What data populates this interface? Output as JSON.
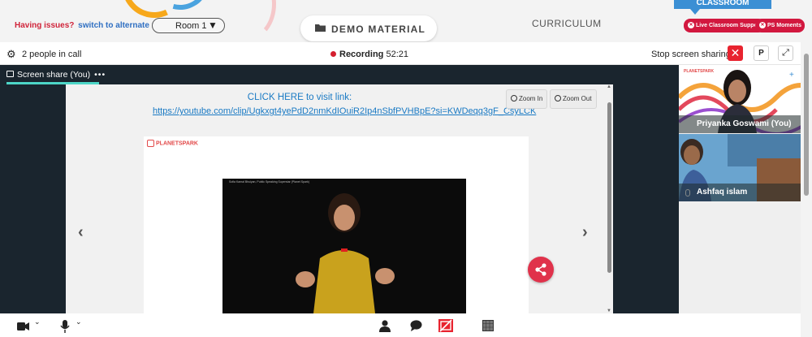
{
  "topbar": {
    "issues_text": "Having issues?",
    "switch_text": "switch to alternate room",
    "room_value": "Room 1",
    "demo_label": "DEMO MATERIAL",
    "curriculum_label": "CURRICULUM",
    "classroom_tab": "CLASSROOM",
    "live_support_label": "Live Classroom Support",
    "ps_moments_label": "PS Moments"
  },
  "call": {
    "people_count": "2 people in call",
    "recording_label": "Recording",
    "recording_time": "52:21",
    "stop_sharing_label": "Stop screen sharing",
    "p_button": "P"
  },
  "share": {
    "tab_label": "Screen share (You)",
    "click_here": "CLICK HERE to visit link:",
    "link": "https://youtube.com/clip/Ugkxgt4yePdD2nmKdIOuiR2Ip4nSbfPVHBpE?si=KWDeqq3gF_CsyLCK",
    "zoom_in": "Zoom In",
    "zoom_out": "Zoom Out",
    "brand": "PLANETSPARK",
    "video_title": "Sofia Kamal Bhuiyan, Public Speaking Superstar (Planet Spark)"
  },
  "participants": [
    {
      "name": "Priyanka Goswami (You)"
    },
    {
      "name": "Ashfaq islam"
    }
  ],
  "colors": {
    "accent_red": "#d2183f",
    "link_blue": "#1a7ac4",
    "tab_teal": "#4dd6c7",
    "dark_bg": "#1a252e"
  },
  "icons": [
    "gear-icon",
    "folder-icon",
    "camera-icon",
    "mic-icon",
    "person-icon",
    "chat-icon",
    "screen-share-off-icon",
    "layout-icon",
    "share-icon"
  ]
}
